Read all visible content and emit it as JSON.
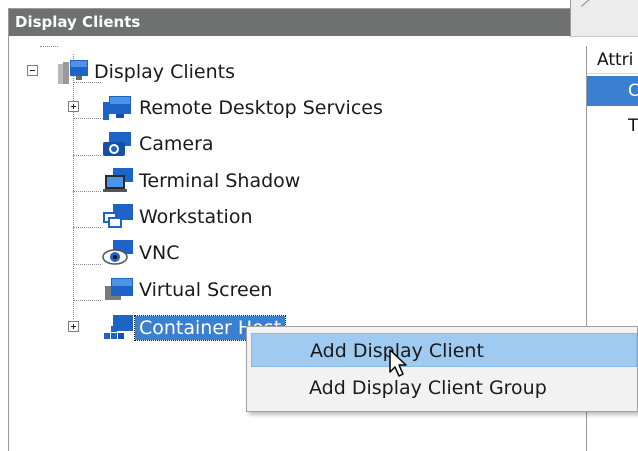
{
  "panel": {
    "title": "Display Clients"
  },
  "tree": {
    "root": {
      "label": "Display Clients",
      "expanded": true,
      "icon": "display-clients-icon"
    },
    "children": [
      {
        "label": "Remote Desktop Services",
        "icon": "remote-desktop-icon",
        "has_children": true
      },
      {
        "label": "Camera",
        "icon": "camera-icon",
        "has_children": false
      },
      {
        "label": "Terminal Shadow",
        "icon": "terminal-shadow-icon",
        "has_children": false
      },
      {
        "label": "Workstation",
        "icon": "workstation-icon",
        "has_children": false
      },
      {
        "label": "VNC",
        "icon": "vnc-icon",
        "has_children": false
      },
      {
        "label": "Virtual Screen",
        "icon": "virtual-screen-icon",
        "has_children": false
      },
      {
        "label": "Container Host",
        "icon": "container-host-icon",
        "has_children": true,
        "selected": true
      }
    ]
  },
  "right_panel": {
    "column_header": "Attri",
    "selected_row": "C",
    "row2": "T"
  },
  "context_menu": {
    "items": [
      {
        "label": "Add Display Client",
        "hover": true
      },
      {
        "label": "Add Display Client Group",
        "hover": false
      }
    ]
  },
  "colors": {
    "selection": "#3b7fd0",
    "menu_hover": "#9fcbf1",
    "header_bg": "#6f7170"
  }
}
